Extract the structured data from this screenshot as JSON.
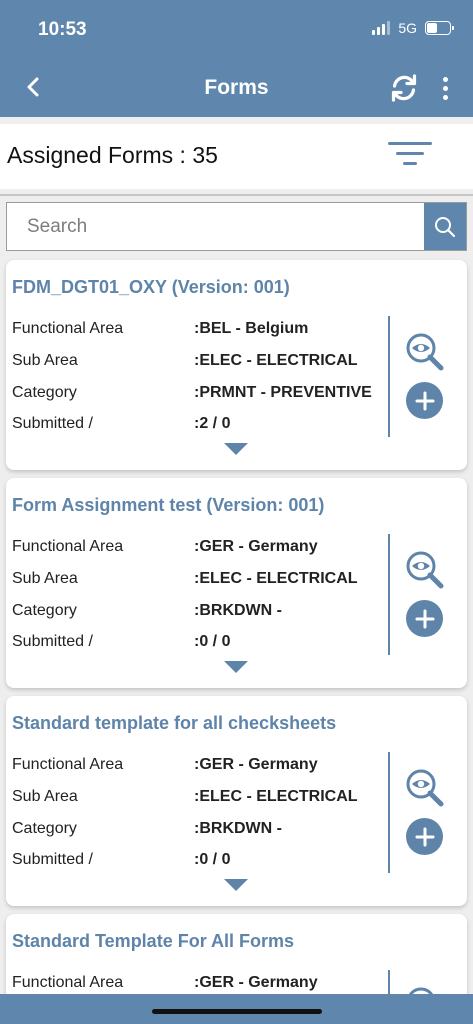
{
  "status_bar": {
    "time": "10:53",
    "network": "5G",
    "battery_level": 0.45
  },
  "header": {
    "title": "Forms",
    "back_icon": "chevron-left-icon",
    "refresh_icon": "refresh-icon",
    "menu_icon": "more-vertical-icon"
  },
  "summary": {
    "assigned_forms_label": "Assigned Forms : 35",
    "filter_icon": "filter-icon"
  },
  "search": {
    "placeholder": "Search",
    "value": "",
    "icon": "search-icon"
  },
  "labels": {
    "functional_area": "Functional Area",
    "sub_area": "Sub Area",
    "category": "Category",
    "submitted": "Submitted /"
  },
  "cards": [
    {
      "title": "FDM_DGT01_OXY (Version: 001)",
      "functional_area": ":BEL - Belgium",
      "sub_area": ":ELEC - ELECTRICAL",
      "category": ":PRMNT - PREVENTIVE",
      "submitted": ":2 / 0"
    },
    {
      "title": "Form Assignment test (Version: 001)",
      "functional_area": ":GER - Germany",
      "sub_area": ":ELEC - ELECTRICAL",
      "category": ":BRKDWN -",
      "submitted": ":0 / 0"
    },
    {
      "title": "Standard template for all checksheets",
      "functional_area": ":GER - Germany",
      "sub_area": ":ELEC - ELECTRICAL",
      "category": ":BRKDWN -",
      "submitted": ":0 / 0"
    },
    {
      "title": "Standard Template For All  Forms",
      "functional_area": ":GER - Germany"
    }
  ],
  "colors": {
    "primary": "#5f86ac",
    "accent_text": "#5e84aa",
    "background": "#eeeeee"
  }
}
